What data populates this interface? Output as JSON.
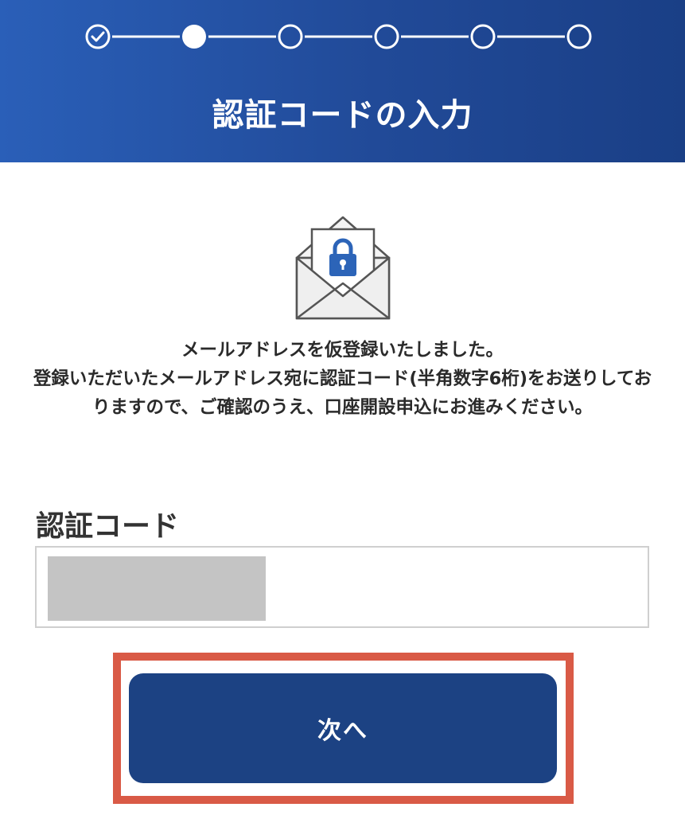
{
  "header": {
    "title": "認証コードの入力",
    "background_start": "#2a5fb8",
    "background_end": "#1a3f86"
  },
  "stepper": {
    "total_steps": 6,
    "completed_steps": 1,
    "current_step": 2,
    "completed_icon": "check-circle-icon",
    "current_icon": "filled-circle-icon",
    "pending_icon": "empty-circle-icon"
  },
  "illustration": {
    "icon": "envelope-lock-icon",
    "lock_color": "#2c64b8"
  },
  "message": {
    "line1": "メールアドレスを仮登録いたしました。",
    "line2": "登録いただいたメールアドレス宛に認証コード(半角数字6桁)をお送りしておりますので、ご確認のうえ、口座開設申込にお進みください。"
  },
  "form": {
    "code_label": "認証コード",
    "code_value": "",
    "code_masked": true
  },
  "actions": {
    "next_label": "次へ",
    "button_color": "#1c4283",
    "highlight_color": "#d95a46"
  }
}
